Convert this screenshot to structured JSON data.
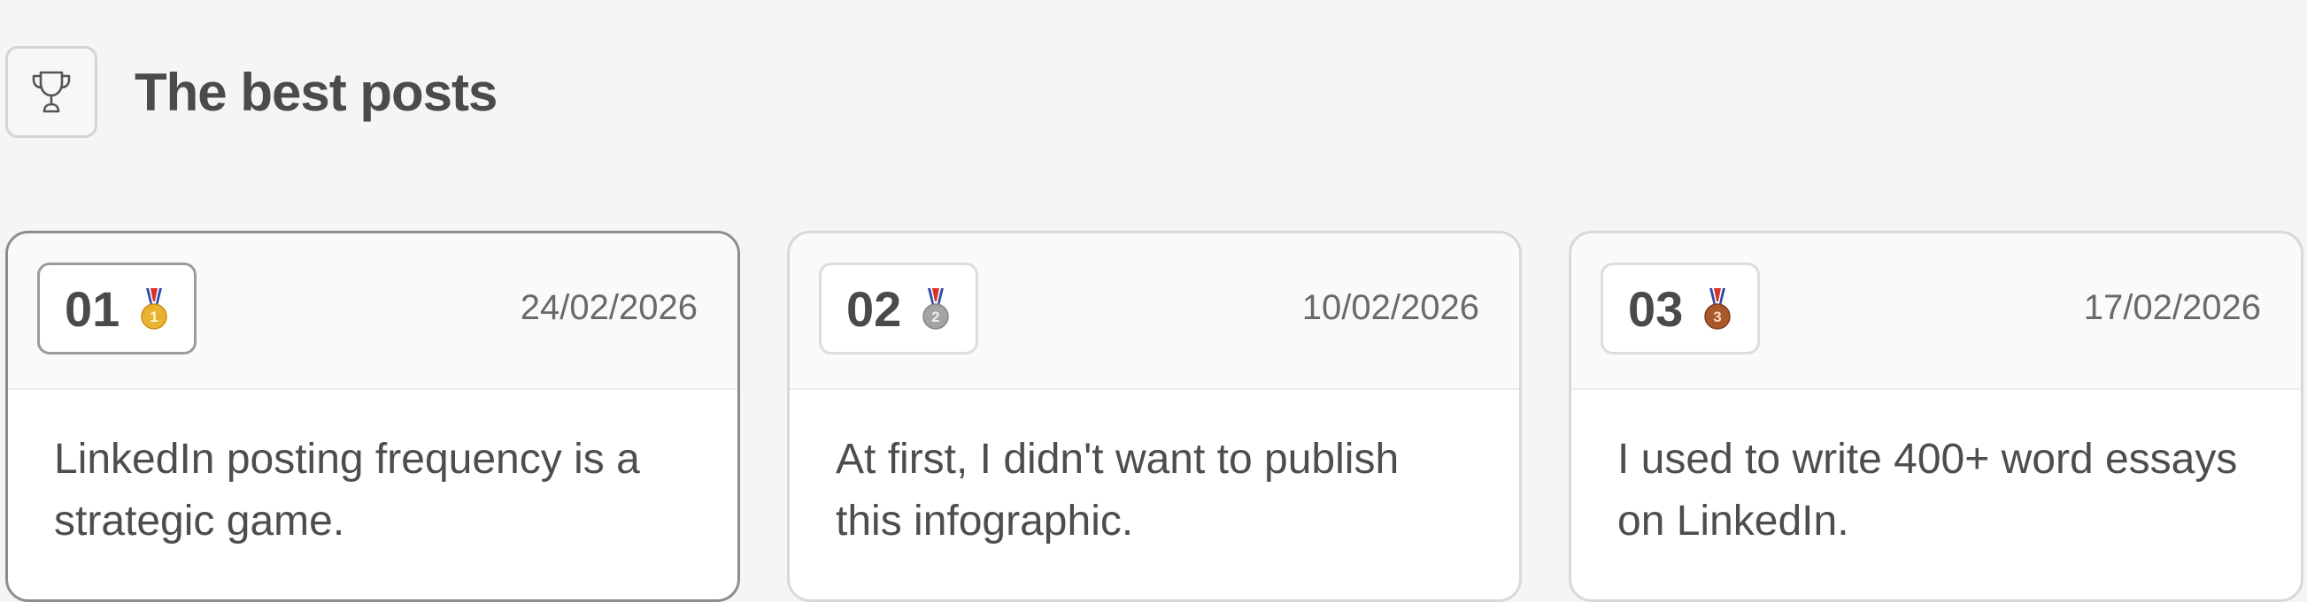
{
  "header": {
    "title": "The best posts",
    "icon": "trophy-icon"
  },
  "posts": [
    {
      "rank": "01",
      "medal": "gold-medal-icon",
      "medal_number": "1",
      "medal_color": "#e9b32f",
      "date": "24/02/2026",
      "excerpt": "LinkedIn posting frequency is a strategic game."
    },
    {
      "rank": "02",
      "medal": "silver-medal-icon",
      "medal_number": "2",
      "medal_color": "#a3a3a3",
      "date": "10/02/2026",
      "excerpt": "At first, I didn't want to publish this infographic."
    },
    {
      "rank": "03",
      "medal": "bronze-medal-icon",
      "medal_number": "3",
      "medal_color": "#a9582b",
      "date": "17/02/2026",
      "excerpt": "I used to write 400+ word essays on LinkedIn."
    }
  ]
}
